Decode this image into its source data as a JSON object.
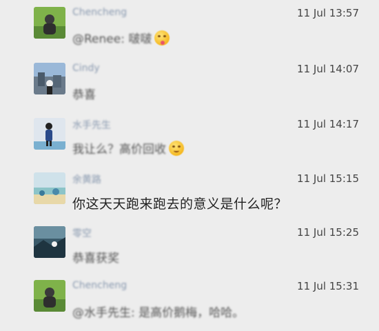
{
  "messages": [
    {
      "name": "Chencheng",
      "time": "11 Jul 13:57",
      "text": "@Renee: 啵啵",
      "emoji": "tongue-emoji-icon",
      "avatar": "avatar-chencheng"
    },
    {
      "name": "Cindy",
      "time": "11 Jul 14:07",
      "text": "恭喜",
      "emoji": "",
      "avatar": "avatar-cindy"
    },
    {
      "name": "水手先生",
      "time": "11 Jul 14:17",
      "text": "我让么？高价回收",
      "emoji": "grin-emoji-icon",
      "avatar": "avatar-sailor"
    },
    {
      "name": "余黄路",
      "time": "11 Jul 15:15",
      "text": "你这天天跑来跑去的意义是什么呢？",
      "emoji": "",
      "avatar": "avatar-yu"
    },
    {
      "name": "零空",
      "time": "11 Jul 15:25",
      "text": "恭喜获奖",
      "emoji": "",
      "avatar": "avatar-lingkong"
    },
    {
      "name": "Chencheng",
      "time": "11 Jul 15:31",
      "text": "@水手先生: 是高价鹅梅，哈哈。",
      "emoji": "",
      "avatar": "avatar-chencheng"
    }
  ],
  "colors": {
    "background": "#ededed",
    "name": "#8a9ab0",
    "time": "#444444"
  }
}
